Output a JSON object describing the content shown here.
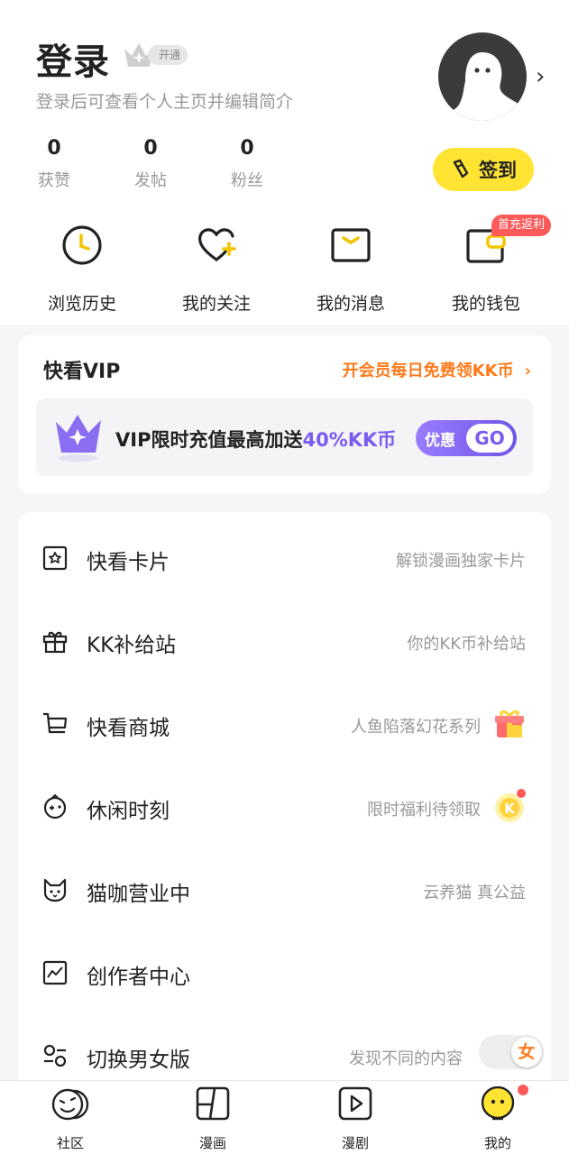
{
  "header": {
    "title": "登录",
    "vip_badge": "开通",
    "subtitle": "登录后可查看个人主页并编辑简介",
    "checkin_label": "签到"
  },
  "stats": [
    {
      "value": "0",
      "label": "获赞"
    },
    {
      "value": "0",
      "label": "发帖"
    },
    {
      "value": "0",
      "label": "粉丝"
    }
  ],
  "quick_actions": [
    {
      "label": "浏览历史",
      "icon": "clock-icon"
    },
    {
      "label": "我的关注",
      "icon": "heart-plus-icon"
    },
    {
      "label": "我的消息",
      "icon": "message-icon"
    },
    {
      "label": "我的钱包",
      "icon": "wallet-icon"
    }
  ],
  "wallet_badge": "首充返利",
  "vip": {
    "title": "快看VIP",
    "promo": "开会员每日免费领KK币",
    "banner_text": "VIP限时充值最高加送",
    "banner_highlight": "40%KK币",
    "button_label": "优惠",
    "button_go": "GO"
  },
  "menu": [
    {
      "title": "快看卡片",
      "hint": "解锁漫画独家卡片",
      "icon": "card-icon"
    },
    {
      "title": "KK补给站",
      "hint": "你的KK币补给站",
      "icon": "gift-box-icon"
    },
    {
      "title": "快看商城",
      "hint": "人鱼陷落幻花系列",
      "icon": "cart-icon"
    },
    {
      "title": "休闲时刻",
      "hint": "限时福利待领取",
      "icon": "gamepad-icon"
    },
    {
      "title": "猫咖营业中",
      "hint": "云养猫 真公益",
      "icon": "cat-icon"
    },
    {
      "title": "创作者中心",
      "hint": "",
      "icon": "chart-icon"
    },
    {
      "title": "切换男女版",
      "hint": "发现不同的内容",
      "icon": "switch-icon"
    }
  ],
  "toggle_label": "女",
  "tabs": [
    {
      "label": "社区",
      "icon": "community-icon"
    },
    {
      "label": "漫画",
      "icon": "comic-icon"
    },
    {
      "label": "漫剧",
      "icon": "play-icon"
    },
    {
      "label": "我的",
      "icon": "profile-face-icon"
    }
  ],
  "colors": {
    "accent_yellow": "#ffe433",
    "promo_orange": "#ff7a1a",
    "vip_purple": "#7a5cf0",
    "badge_red": "#ff5a5a"
  }
}
